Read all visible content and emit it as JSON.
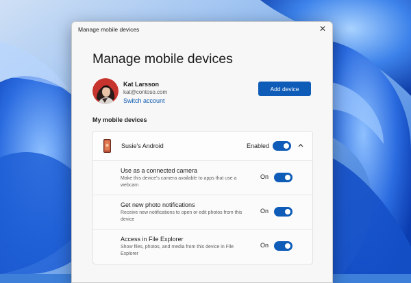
{
  "window": {
    "title": "Manage mobile devices",
    "close_icon": "close-icon",
    "close_glyph": "✕"
  },
  "page": {
    "heading": "Manage mobile devices"
  },
  "account": {
    "avatar_icon": "user-avatar",
    "name": "Kat Larsson",
    "email": "kat@contoso.com",
    "switch_label": "Switch account",
    "add_device_label": "Add device"
  },
  "section": {
    "label": "My mobile devices"
  },
  "device": {
    "name": "Susie's Android",
    "status": "Enabled",
    "enabled": true,
    "icon": "phone-icon",
    "expand_icon": "chevron-up-icon"
  },
  "settings": [
    {
      "title": "Use as a connected camera",
      "description": "Make this device's camera available to apps that use a webcam",
      "state": "On",
      "on": true
    },
    {
      "title": "Get new photo notifications",
      "description": "Receive new notifications to open or edit photos from this device",
      "state": "On",
      "on": true
    },
    {
      "title": "Access in File Explorer",
      "description": "Show files, photos, and media from this device in File Explorer",
      "state": "On",
      "on": true
    }
  ],
  "colors": {
    "accent": "#0f5cb8",
    "link": "#0a5ab0",
    "wallpaper_base": "#3d7fd9"
  }
}
